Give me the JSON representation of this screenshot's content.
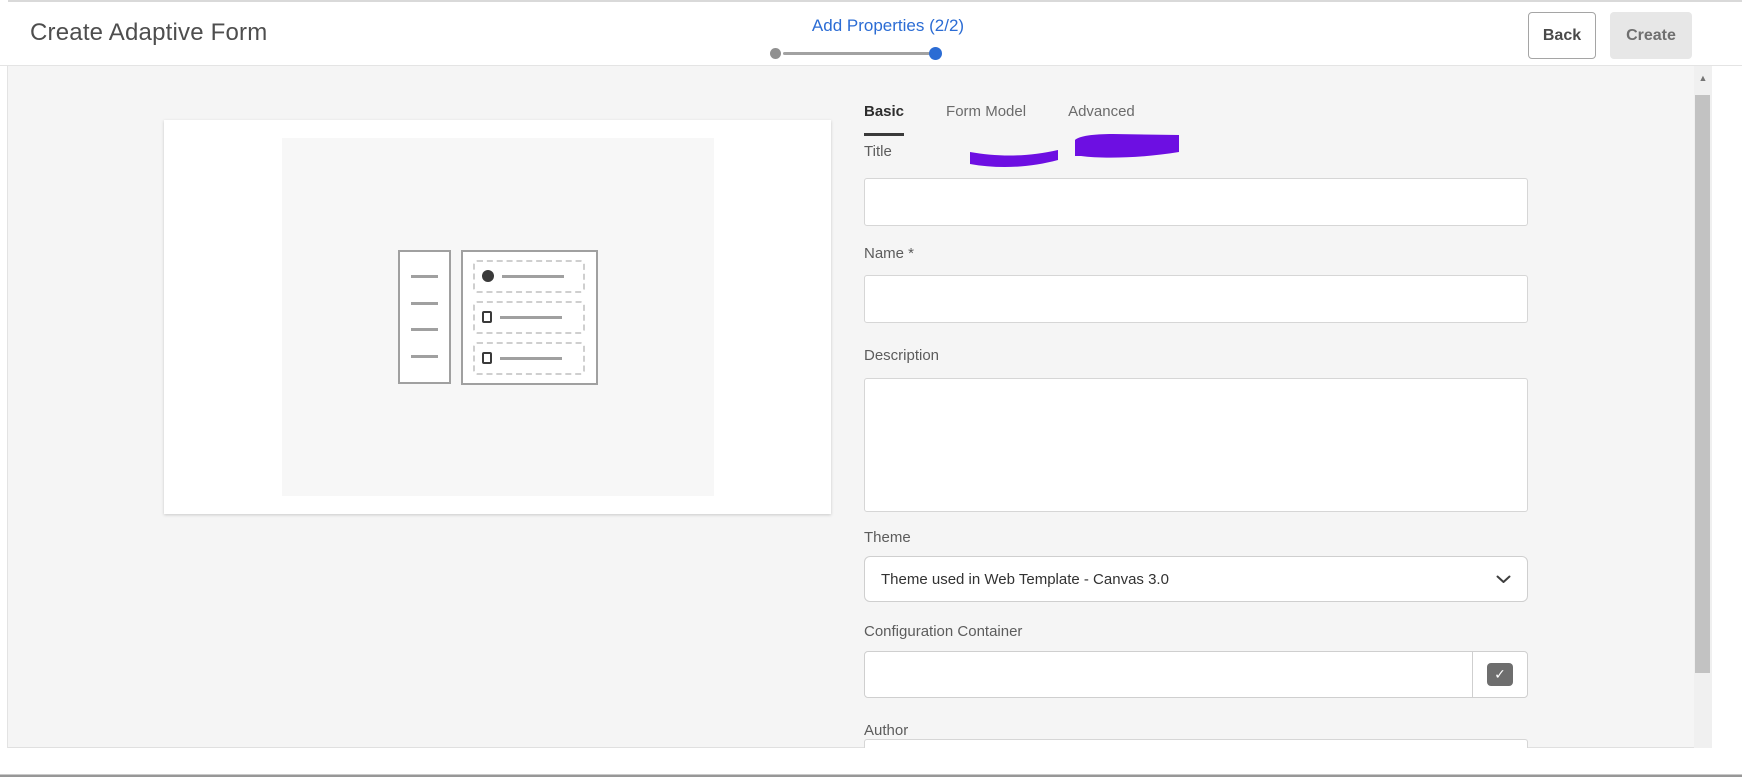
{
  "header": {
    "title": "Create Adaptive Form",
    "step_label": "Add Properties (2/2)",
    "buttons": {
      "back": "Back",
      "create": "Create"
    }
  },
  "progress": {
    "total_steps": 2,
    "current_step": 2
  },
  "tabs": [
    {
      "label": "Basic",
      "active": true
    },
    {
      "label": "Form Model",
      "active": false
    },
    {
      "label": "Advanced",
      "active": false
    }
  ],
  "annotations": [
    {
      "type": "marker-stroke",
      "color": "#6d0fe2",
      "near_tab": "Form Model"
    },
    {
      "type": "marker-stroke",
      "color": "#6d0fe2",
      "near_tab": "Advanced"
    }
  ],
  "form": {
    "title": {
      "label": "Title",
      "value": "",
      "placeholder": ""
    },
    "name": {
      "label": "Name *",
      "value": "",
      "placeholder": ""
    },
    "description": {
      "label": "Description",
      "value": "",
      "placeholder": ""
    },
    "theme": {
      "label": "Theme",
      "selected": "Theme used in Web Template - Canvas 3.0"
    },
    "configuration_container": {
      "label": "Configuration Container",
      "value": "",
      "checked": true
    },
    "author": {
      "label": "Author"
    }
  },
  "icons": {
    "chevron_down": "⌄",
    "check": "✓",
    "scroll_up": "▲"
  },
  "colors": {
    "accent_blue": "#2b6cd4",
    "annotation_purple": "#6d0fe2",
    "content_bg": "#f5f5f5"
  }
}
